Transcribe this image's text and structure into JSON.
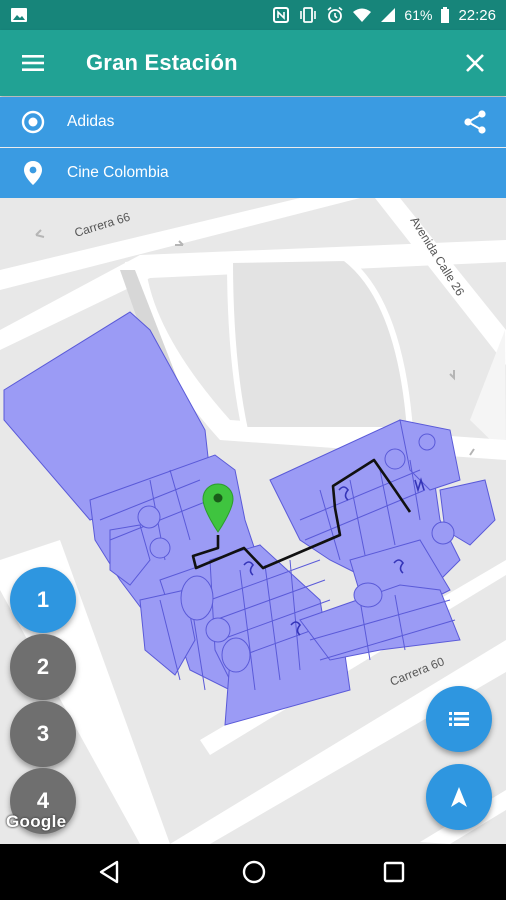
{
  "status_bar": {
    "battery_percent": "61%",
    "time": "22:26",
    "icons": [
      "image-icon",
      "nfc-icon",
      "vibrate-icon",
      "alarm-icon",
      "wifi-icon",
      "signal-icon",
      "battery-icon"
    ]
  },
  "app_bar": {
    "title": "Gran Estación",
    "menu_icon": "menu-icon",
    "close_icon": "close-icon"
  },
  "route": {
    "origin": "Adidas",
    "destination": "Cine Colombia",
    "origin_icon": "target-icon",
    "destination_icon": "map-pin-icon",
    "share_icon": "share-icon"
  },
  "map": {
    "street_labels": [
      "Carrera 66",
      "Avenida Calle 26",
      "Carrera 60"
    ],
    "attribution": "Google",
    "colors": {
      "building": "#9b9bf5",
      "building_outline": "#5a5ad8",
      "route": "#111111",
      "marker": "#3fc43f",
      "road": "#ffffff",
      "ground": "#eaeaea"
    }
  },
  "floors": {
    "items": [
      "1",
      "2",
      "3",
      "4"
    ],
    "active": "1"
  },
  "actions": {
    "list_icon": "list-icon",
    "navigate_icon": "navigation-arrow-icon"
  },
  "nav_bar": {
    "icons": [
      "back-icon",
      "home-icon",
      "recents-icon"
    ]
  }
}
